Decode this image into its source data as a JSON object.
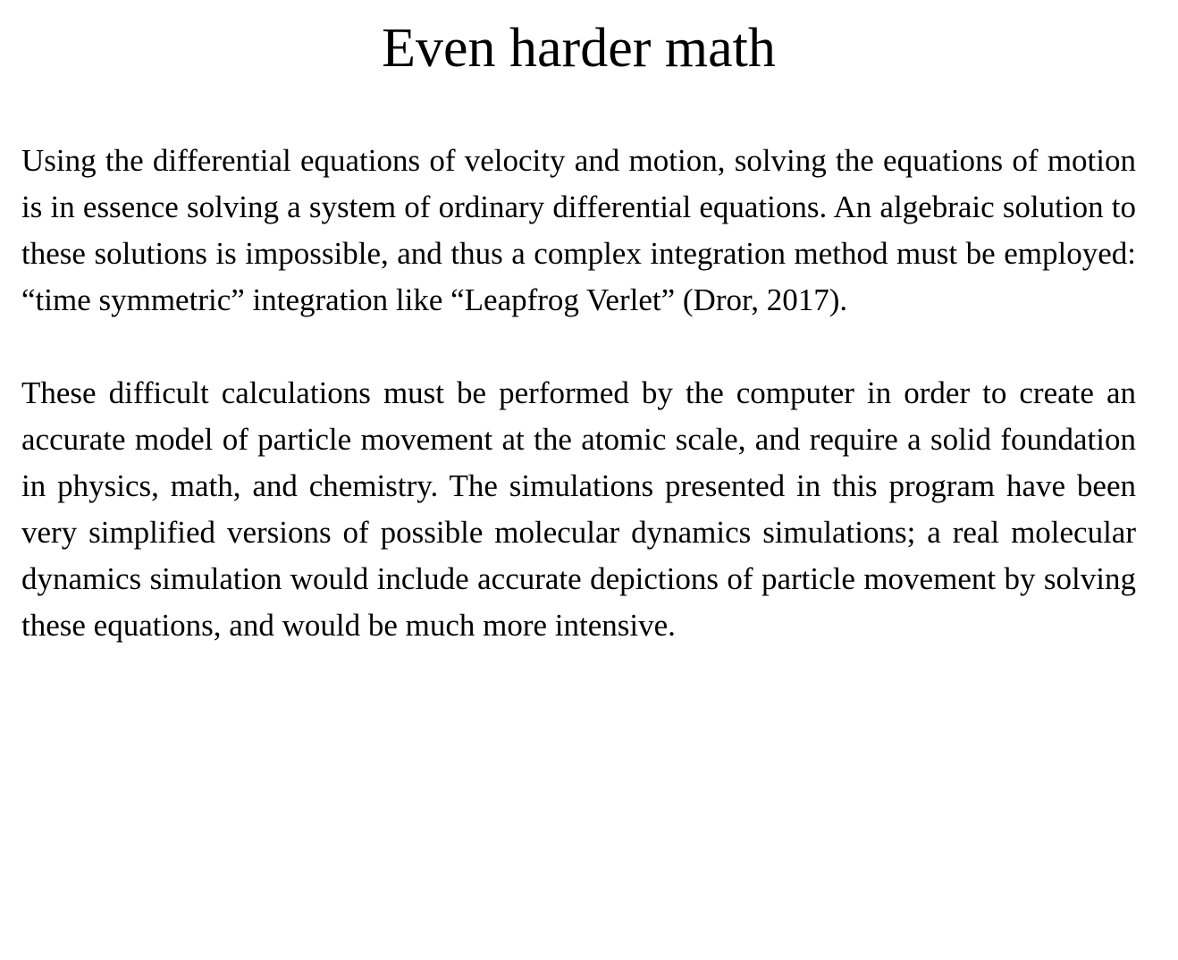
{
  "document": {
    "title": "Even harder math",
    "paragraphs": [
      "Using the differential equations of velocity and motion, solving the equations of motion is in essence solving a system of ordinary differential equations. An algebraic solution to these solutions is impossible, and thus a complex integration method must be employed: “time symmetric” integration like “Leapfrog Verlet” (Dror, 2017).",
      "These difficult calculations must be performed by the computer in order to create an accurate model of particle movement at the atomic scale, and require a solid foundation in physics, math, and chemistry. The simulations presented in this program have been very simplified versions of possible molecular dynamics simulations; a real molecular dynamics simulation would include accurate depictions of particle movement by solving these equations, and would be much more intensive."
    ]
  },
  "colors": {
    "background": "#ffffff",
    "text": "#000000"
  }
}
